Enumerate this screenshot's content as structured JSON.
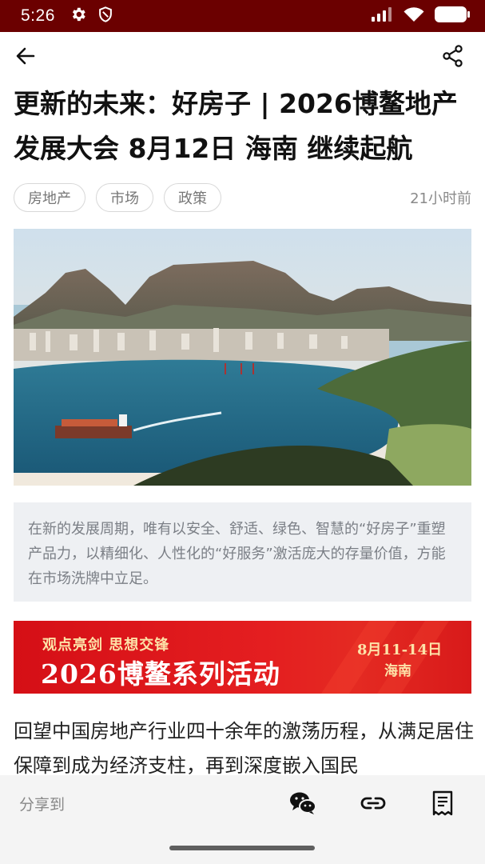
{
  "status_bar": {
    "time": "5:26",
    "icons_left": [
      "gear-icon",
      "shield-icon"
    ],
    "icons_right": [
      "signal-icon",
      "wifi-icon",
      "battery-icon"
    ],
    "background": "#6b0000"
  },
  "nav": {
    "back_icon": "arrow-left-icon",
    "share_icon": "share-icon"
  },
  "article": {
    "title": "更新的未来：好房子 | 2026博鳌地产发展大会 8月12日 海南 继续起航",
    "tags": [
      "房地产",
      "市场",
      "政策"
    ],
    "time_ago": "21小时前",
    "summary": "在新的发展周期，唯有以安全、舒适、绿色、智慧的“好房子”重塑产品力，以精细化、人性化的“好服务”激活庞大的存量价值，方能在市场洗牌中立足。",
    "body": "回望中国房地产行业四十余年的激荡历程，从满足居住保障到成为经济支柱，再到深度嵌入国民"
  },
  "banner": {
    "slogan": "观点亮剑 思想交锋",
    "headline": "2026博鳌系列活动",
    "date": "8月11-14日",
    "place": "海南",
    "color": "#d50f16"
  },
  "share_bar": {
    "label": "分享到",
    "icons": [
      "wechat-icon",
      "link-icon",
      "poster-icon"
    ]
  }
}
